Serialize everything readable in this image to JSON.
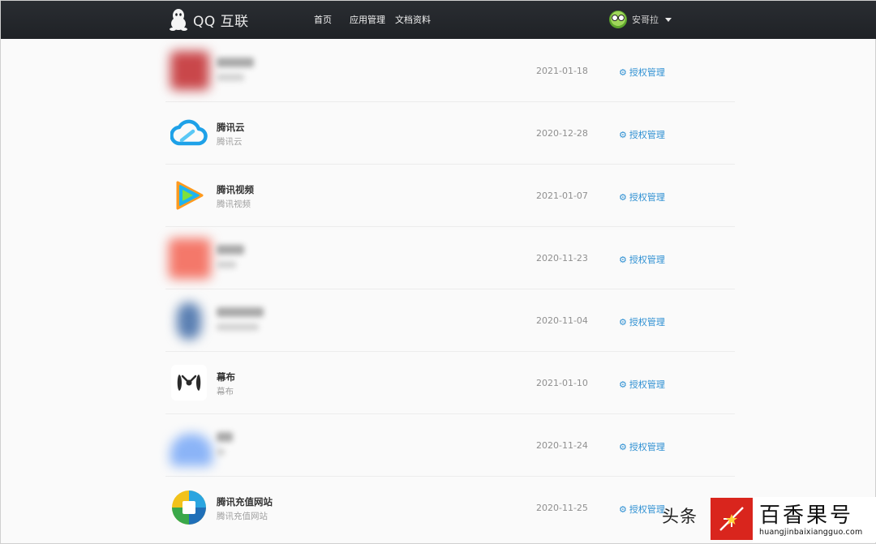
{
  "header": {
    "logo_text": "QQ 互联",
    "nav": [
      {
        "label": "首页"
      },
      {
        "label": "应用管理"
      },
      {
        "label": "文档资料"
      }
    ],
    "user_name": "安哥拉"
  },
  "apps": [
    {
      "name": "",
      "sub": "",
      "date": "2021-01-18",
      "action": "授权管理",
      "icon": "blurred-red-icon"
    },
    {
      "name": "腾讯云",
      "sub": "腾讯云",
      "date": "2020-12-28",
      "action": "授权管理",
      "icon": "tencent-cloud-icon"
    },
    {
      "name": "腾讯视频",
      "sub": "腾讯视频",
      "date": "2021-01-07",
      "action": "授权管理",
      "icon": "tencent-video-icon"
    },
    {
      "name": "",
      "sub": "",
      "date": "2020-11-23",
      "action": "授权管理",
      "icon": "blurred-salmon-icon"
    },
    {
      "name": "",
      "sub": "",
      "date": "2020-11-04",
      "action": "授权管理",
      "icon": "blurred-blue-icon"
    },
    {
      "name": "幕布",
      "sub": "幕布",
      "date": "2021-01-10",
      "action": "授权管理",
      "icon": "mubu-icon"
    },
    {
      "name": "",
      "sub": "",
      "date": "2020-11-24",
      "action": "授权管理",
      "icon": "blurred-lightblue-icon"
    },
    {
      "name": "腾讯充值网站",
      "sub": "腾讯充值网站",
      "date": "2020-11-25",
      "action": "授权管理",
      "icon": "tencent-recharge-icon"
    }
  ],
  "watermark": {
    "left_text": "头条",
    "brand": "百香果号",
    "url": "huangjinbaixiangguo.com"
  }
}
